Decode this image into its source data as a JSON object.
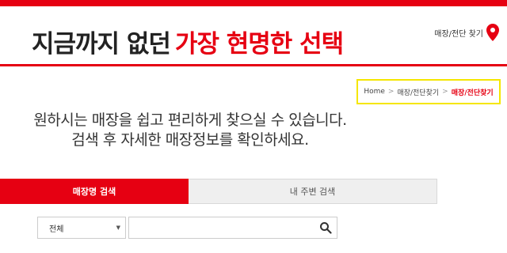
{
  "colors": {
    "brand": "#e60012",
    "breadcrumb_highlight": "#f5e600"
  },
  "header": {
    "slogan_plain": "지금까지 없던",
    "slogan_accent": "가장 현명한 선택",
    "store_link_label": "매장/전단 찾기",
    "store_link_icon": "map-pin-icon"
  },
  "breadcrumb": {
    "home": "Home",
    "separator": ">",
    "parent": "매장/전단찾기",
    "current": "매장/전단찾기"
  },
  "intro": {
    "line1": "원하시는 매장을 쉽고 편리하게 찾으실 수 있습니다.",
    "line2": "검색 후 자세한 매장정보를 확인하세요."
  },
  "tabs": [
    {
      "label": "매장명 검색",
      "active": true
    },
    {
      "label": "내 주변 검색",
      "active": false
    }
  ],
  "search": {
    "select_value": "전체",
    "input_value": "",
    "icon": "search-icon"
  }
}
